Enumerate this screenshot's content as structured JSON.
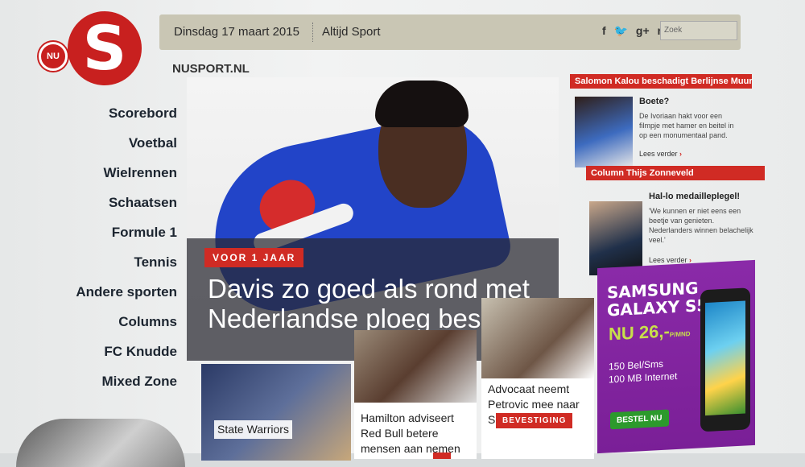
{
  "brand": {
    "nu_label": "NU",
    "logo_letter": "S"
  },
  "topbar": {
    "date": "Dinsdag 17 maart 2015",
    "tagline": "Altijd Sport",
    "social": [
      "f",
      "🐦",
      "g+",
      "rss"
    ],
    "search_placeholder": "Zoek"
  },
  "site_label": "NUSPORT.NL",
  "nav": [
    "Scorebord",
    "Voetbal",
    "Wielrennen",
    "Schaatsen",
    "Formule 1",
    "Tennis",
    "Andere sporten",
    "Columns",
    "FC Knudde",
    "Mixed Zone"
  ],
  "hero": {
    "badge": "VOOR 1 JAAR",
    "title": "Davis zo goed als rond met Nederlandse ploeg beslist.nl"
  },
  "thumbs": [
    {
      "caption": "State Warriors"
    },
    {
      "caption": "Hamilton adviseert Red Bull betere mensen aan nemen"
    },
    {
      "caption": "Advocaat neemt Petrovic mee naar Sunderland",
      "camera": "📷",
      "badge": "BEVESTIGING"
    }
  ],
  "right": {
    "section1": "Salomon Kalou beschadigt Berlijnse Muur",
    "article1": {
      "heading": "Boete?",
      "text": "De Ivoriaan hakt voor een filmpje met hamer en beitel in op een monumentaal pand.",
      "more": "Lees verder"
    },
    "section2": "Column Thijs Zonneveld",
    "article2": {
      "heading": "Hal-lo medailleplegel!",
      "text": "'We kunnen er niet eens een beetje van genieten. Nederlanders winnen belachelijk veel.'",
      "more": "Lees verder"
    }
  },
  "ad": {
    "brand": "SAMSUNG GALAXY S5",
    "price": "NU 26,-",
    "price_unit": "P/MND",
    "line1": "150 Bel/Sms",
    "line2": "100 MB Internet",
    "button": "BESTEL NU"
  },
  "colors": {
    "brand_red": "#c8201f",
    "accent_purple": "#8a2aa8"
  }
}
